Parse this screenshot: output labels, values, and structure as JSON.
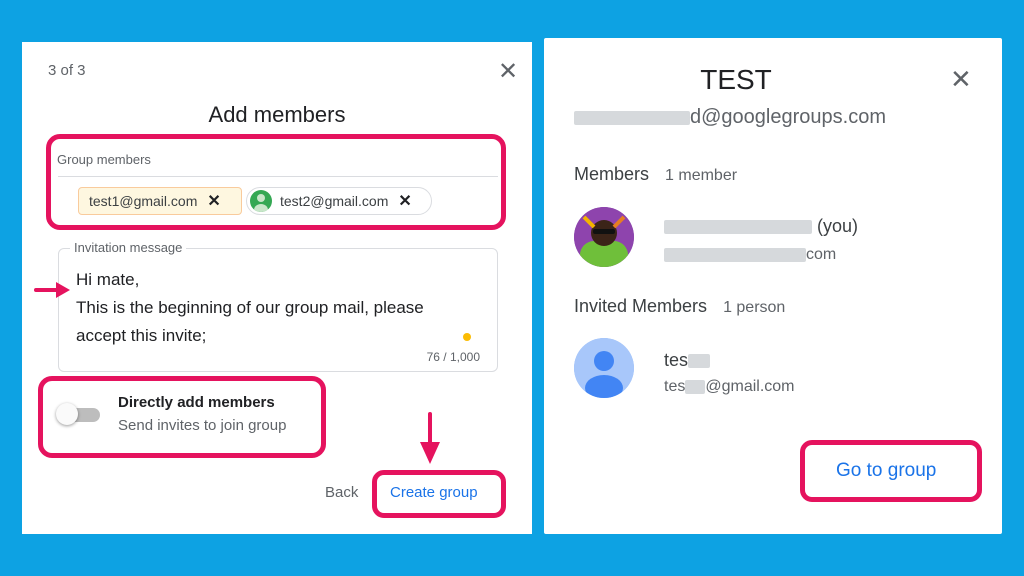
{
  "colors": {
    "background": "#0da2e3",
    "highlight": "#e5135e",
    "link": "#1a73e8"
  },
  "left_dialog": {
    "step": "3 of 3",
    "close_icon": "close-icon",
    "title": "Add members",
    "group_members_label": "Group members",
    "chips": [
      {
        "email": "test1@gmail.com"
      },
      {
        "email": "test2@gmail.com"
      }
    ],
    "invitation_label": "Invitation message",
    "message_lines": [
      "Hi mate,",
      "This is the beginning of our group mail, please",
      "accept this invite;"
    ],
    "char_count": "76 / 1,000",
    "toggle": {
      "title": "Directly add members",
      "subtitle": "Send invites to join group",
      "checked": false
    },
    "back_label": "Back",
    "create_label": "Create group"
  },
  "right_dialog": {
    "title": "TEST",
    "email_visible": "d@googlegroups.com",
    "close_icon": "close-icon",
    "members_heading": "Members",
    "members_count": "1 member",
    "member": {
      "name_visible": "(you)",
      "email_visible": "com"
    },
    "invited_heading": "Invited Members",
    "invited_count": "1 person",
    "invited": {
      "name_visible": "tes",
      "email_visible": "@gmail.com"
    },
    "go_label": "Go to group"
  }
}
